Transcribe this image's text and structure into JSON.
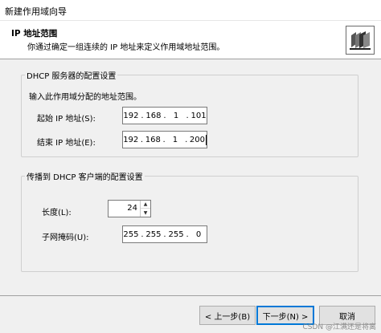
{
  "window": {
    "title": "新建作用域向导"
  },
  "header": {
    "title": "IP 地址范围",
    "subtitle": "你通过确定一组连续的 IP 地址来定义作用域地址范围。",
    "icon": "wizard-folder-icon"
  },
  "dhcp_server_group": {
    "legend": "DHCP 服务器的配置设置",
    "instruction": "输入此作用域分配的地址范围。",
    "start_ip": {
      "label": "起始 IP 地址(S):",
      "octets": [
        "192",
        "168",
        "1",
        "101"
      ]
    },
    "end_ip": {
      "label": "结束 IP 地址(E):",
      "octets": [
        "192",
        "168",
        "1",
        "200"
      ]
    }
  },
  "dhcp_client_group": {
    "legend": "传播到 DHCP 客户端的配置设置",
    "length": {
      "label": "长度(L):",
      "value": "24"
    },
    "subnet_mask": {
      "label": "子网掩码(U):",
      "octets": [
        "255",
        "255",
        "255",
        "0"
      ]
    }
  },
  "buttons": {
    "back": "< 上一步(B)",
    "next": "下一步(N) >",
    "cancel": "取消"
  },
  "watermark": "CSDN @江满还是将离"
}
